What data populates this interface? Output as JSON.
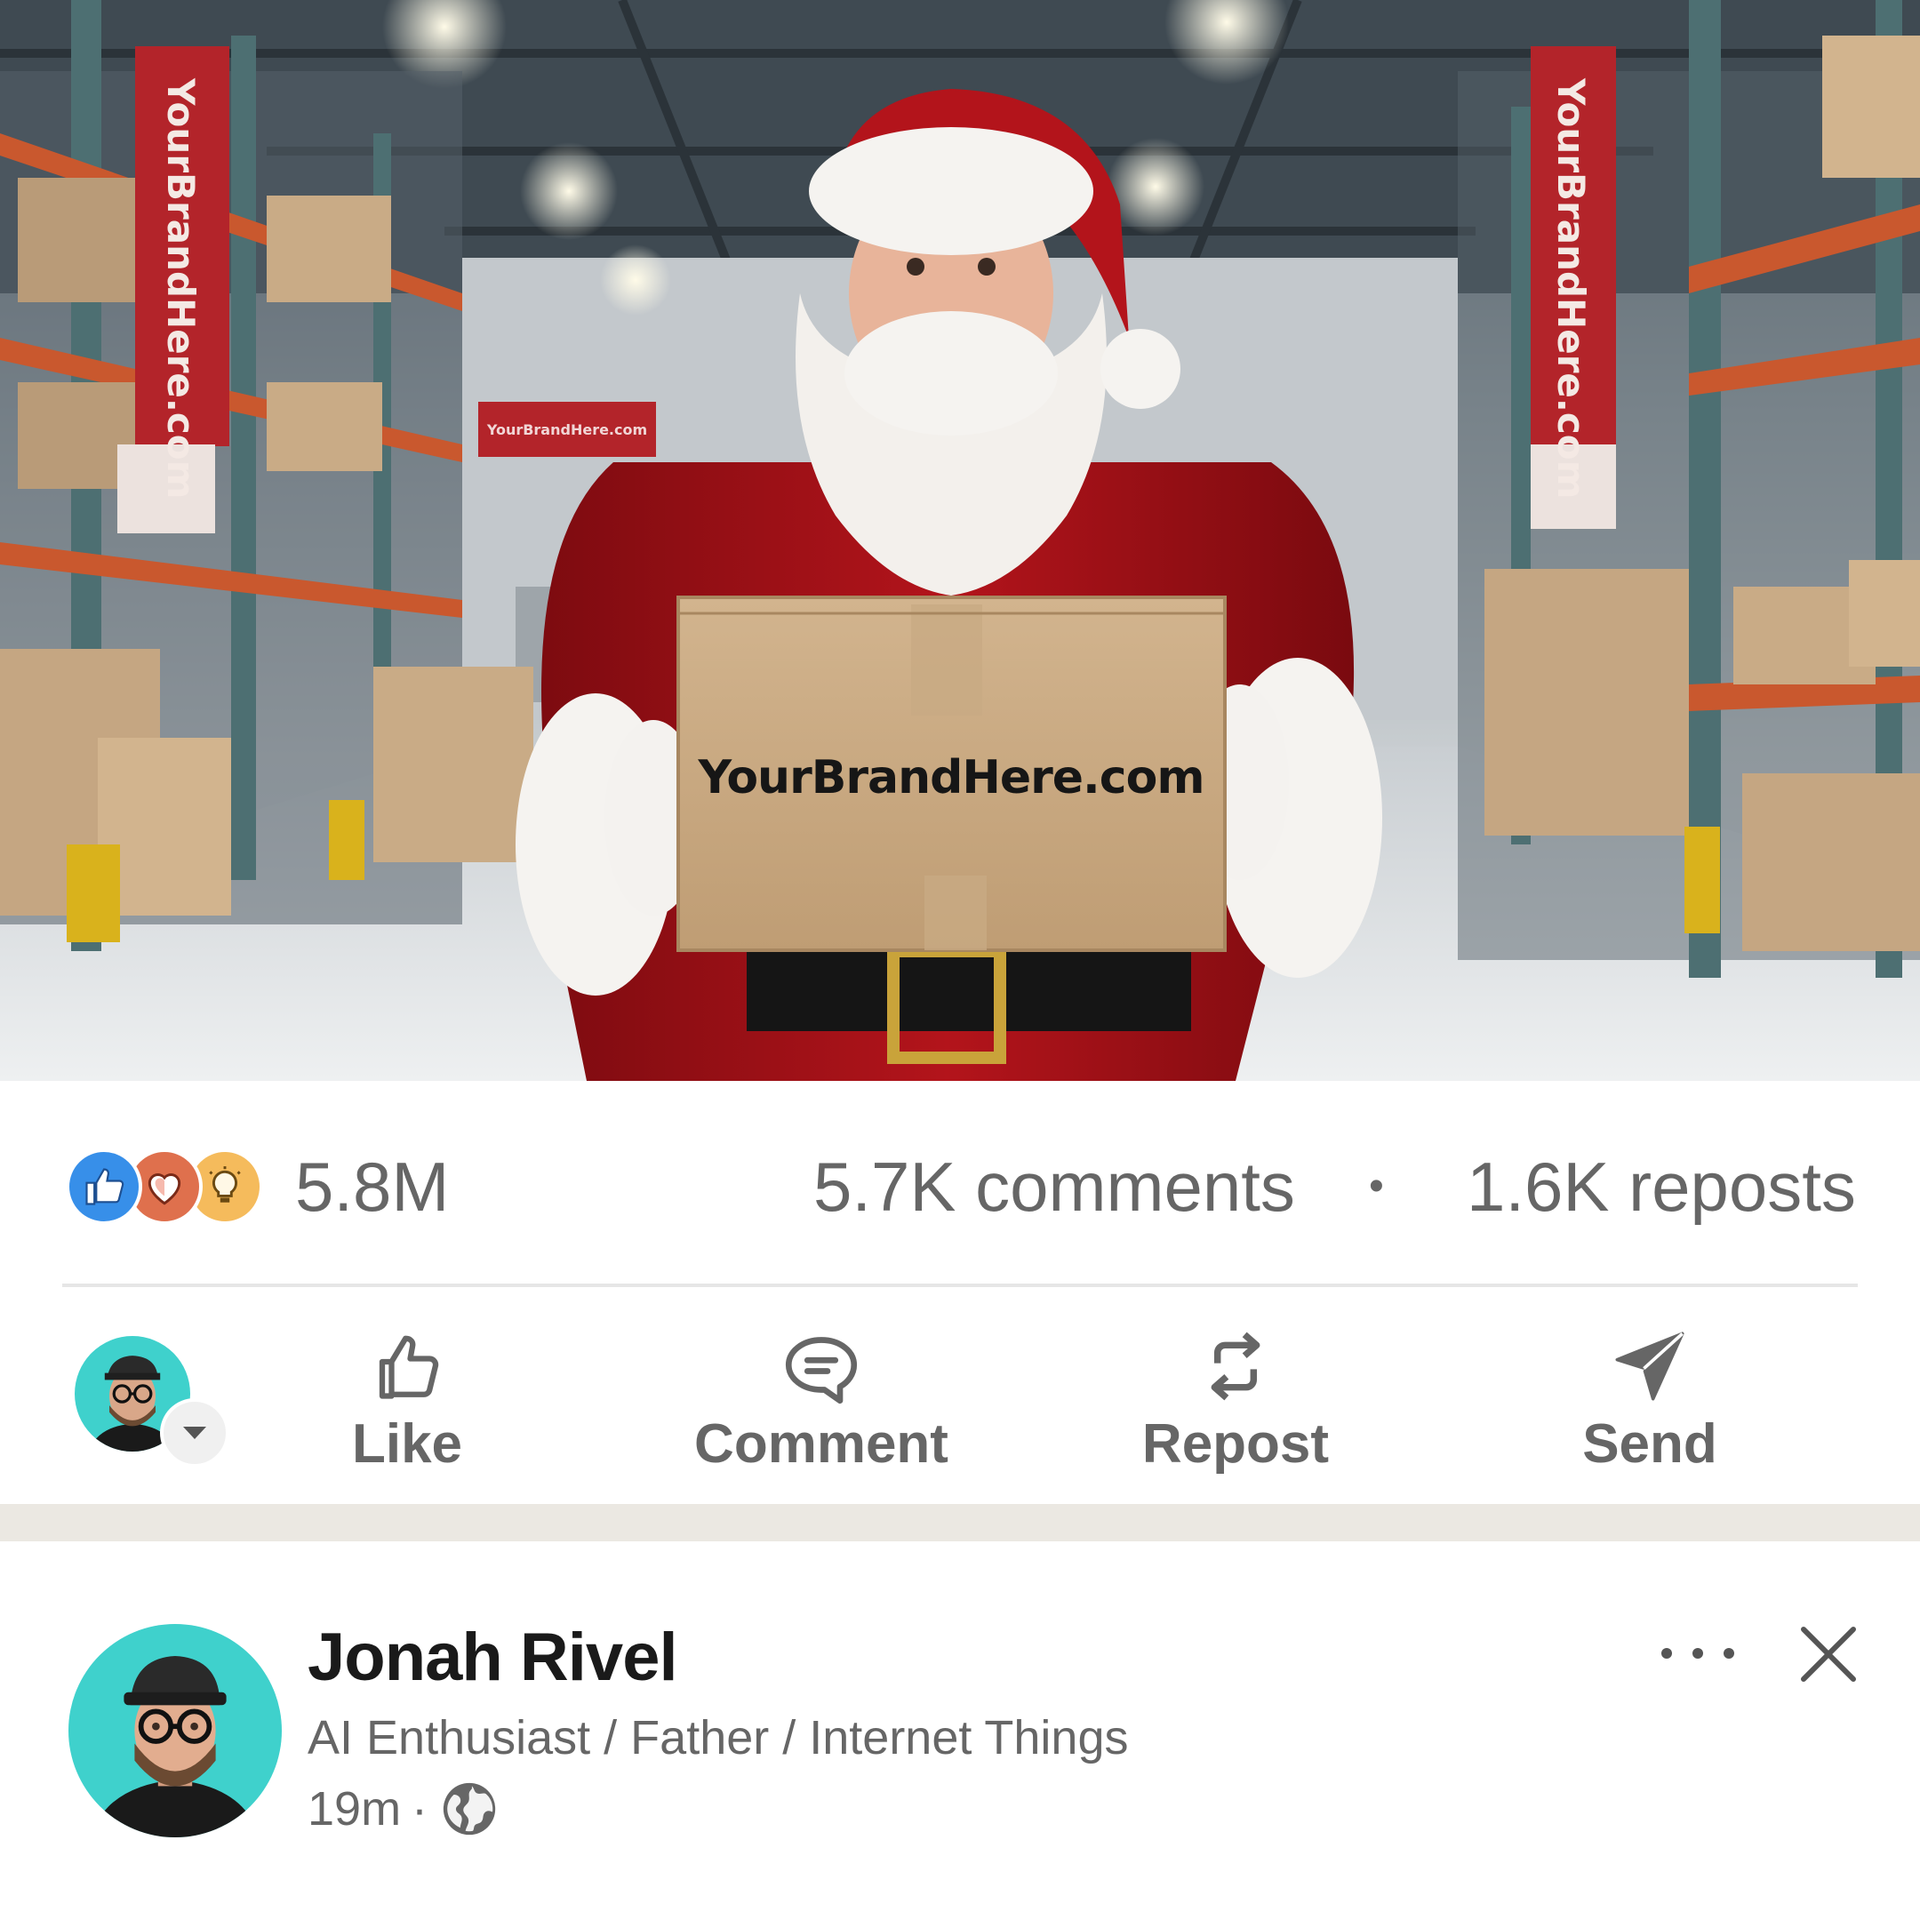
{
  "post": {
    "image_alt": "Santa Claus holding a cardboard box in a warehouse",
    "box_brand": "YourBrandHere.com",
    "banner_left": "YourBrandHere.com",
    "banner_right": "YourBrandHere.com",
    "wall_sign": "YourBrandHere.com"
  },
  "stats": {
    "reactions": [
      "like-icon",
      "love-icon",
      "insightful-icon"
    ],
    "reaction_count": "5.8M",
    "comments": "5.7K comments",
    "separator": "•",
    "reposts": "1.6K reposts"
  },
  "actions": {
    "like": "Like",
    "comment": "Comment",
    "repost": "Repost",
    "send": "Send"
  },
  "author": {
    "name": "Jonah Rivel",
    "headline": "AI Enthusiast / Father / Internet Things",
    "time": "19m",
    "dot": "·",
    "visibility_icon": "globe-icon"
  },
  "colors": {
    "like": "#378fe9",
    "love": "#df704d",
    "insightful": "#f5bb5c",
    "avatar_bg": "#3fd1cc",
    "band": "#ebe8e2"
  }
}
